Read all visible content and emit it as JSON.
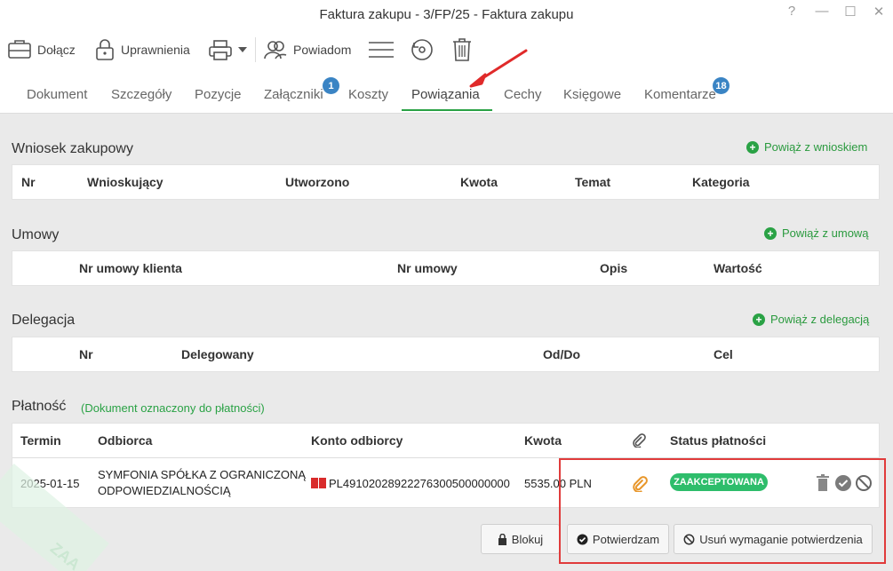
{
  "window": {
    "title": "Faktura zakupu - 3/FP/25 - Faktura zakupu",
    "controls": [
      "?",
      "—",
      "☐",
      "✕"
    ]
  },
  "toolbar": {
    "attach_label": "Dołącz",
    "permissions_label": "Uprawnienia",
    "notify_label": "Powiadom"
  },
  "tabs": [
    {
      "label": "Dokument"
    },
    {
      "label": "Szczegóły"
    },
    {
      "label": "Pozycje"
    },
    {
      "label": "Załączniki",
      "badge": "1"
    },
    {
      "label": "Koszty"
    },
    {
      "label": "Powiązania"
    },
    {
      "label": "Cechy"
    },
    {
      "label": "Księgowe"
    },
    {
      "label": "Komentarze",
      "badge": "18"
    }
  ],
  "active_tab": "Powiązania",
  "purchase_request": {
    "title": "Wniosek zakupowy",
    "add_label": "Powiąż z wnioskiem",
    "columns": [
      "Nr",
      "Wnioskujący",
      "Utworzono",
      "Kwota",
      "Temat",
      "Kategoria"
    ]
  },
  "contracts": {
    "title": "Umowy",
    "add_label": "Powiąż z umową",
    "columns": [
      "Nr umowy klienta",
      "Nr umowy",
      "Opis",
      "Wartość"
    ]
  },
  "delegation": {
    "title": "Delegacja",
    "add_label": "Powiąż z delegacją",
    "columns": [
      "Nr",
      "Delegowany",
      "Od/Do",
      "Cel"
    ]
  },
  "payment": {
    "title": "Płatność",
    "note": "(Dokument oznaczony do płatności)",
    "columns": [
      "Termin",
      "Odbiorca",
      "Konto odbiorcy",
      "Kwota",
      "Status płatności"
    ],
    "row": {
      "due_date": "2025-01-15",
      "recipient_line1": "SYMFONIA SPÓŁKA Z OGRANICZONĄ",
      "recipient_line2": "ODPOWIEDZIALNOŚCIĄ",
      "account": "PL49102028922276300500000000",
      "amount": "5535.00 PLN",
      "status": "ZAAKCEPTOWANA"
    }
  },
  "actions": {
    "block_label": "Blokuj",
    "confirm_label": "Potwierdzam",
    "remove_requirement_label": "Usuń wymaganie potwierdzenia"
  },
  "watermark_text": "ZAA",
  "colors": {
    "accent_green": "#2aa245",
    "badge_blue": "#3a84c4",
    "status_green": "#2ebd6b",
    "highlight_red": "#e03b3b"
  }
}
